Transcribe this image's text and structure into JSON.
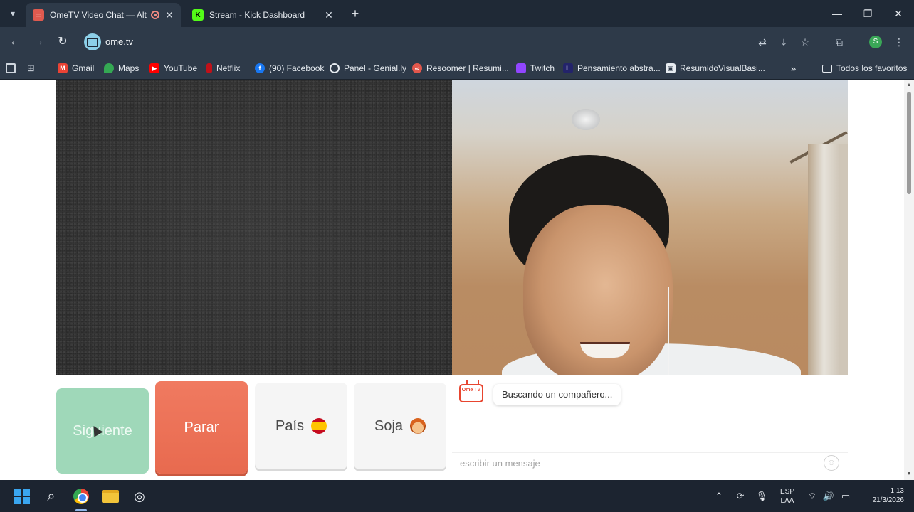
{
  "browser": {
    "tabs": [
      {
        "title": "OmeTV Video Chat — Alter",
        "active": true
      },
      {
        "title": "Stream - Kick Dashboard",
        "active": false
      }
    ],
    "url": "ome.tv",
    "profile_initial": "S",
    "bookmarks": [
      {
        "label": "Gmail",
        "icon": "gmail-icon"
      },
      {
        "label": "Maps",
        "icon": "maps-icon"
      },
      {
        "label": "YouTube",
        "icon": "youtube-icon"
      },
      {
        "label": "Netflix",
        "icon": "netflix-icon"
      },
      {
        "label": "(90) Facebook",
        "icon": "facebook-icon"
      },
      {
        "label": "Panel - Genial.ly",
        "icon": "genially-icon"
      },
      {
        "label": "Resoomer | Resumi...",
        "icon": "resoomer-icon"
      },
      {
        "label": "Twitch",
        "icon": "twitch-icon"
      },
      {
        "label": "Pensamiento abstra...",
        "icon": "letter-l-icon"
      },
      {
        "label": "ResumidoVisualBasi...",
        "icon": "image-icon"
      }
    ],
    "all_bookmarks_label": "Todos los favoritos"
  },
  "ometv": {
    "buttons": {
      "next": "Siguiente",
      "stop": "Parar",
      "country": "País",
      "gender": "Soja"
    },
    "logo_text": "Ome TV",
    "status_message": "Buscando un compañero...",
    "message_placeholder": "escribir un mensaje"
  },
  "taskbar": {
    "language": "ESP",
    "layout": "LAA",
    "time": "1:13",
    "date": "21/3/2026"
  },
  "colors": {
    "next_button": "#9fd8b9",
    "stop_button": "#e86a4f",
    "browser_chrome": "#2e3a49"
  }
}
